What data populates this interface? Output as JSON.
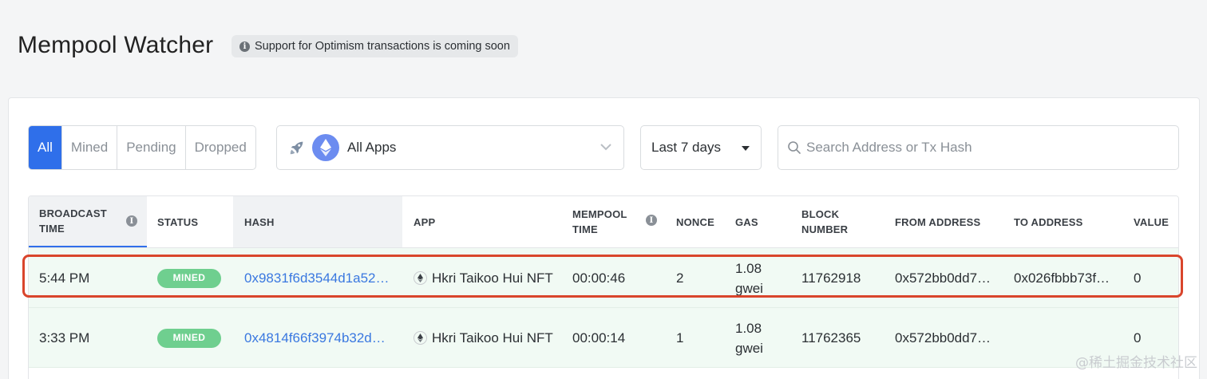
{
  "header": {
    "title": "Mempool Watcher",
    "notice": "Support for Optimism transactions is coming soon",
    "notice_icon": "info-icon"
  },
  "filters": {
    "tabs": [
      {
        "label": "All",
        "active": true
      },
      {
        "label": "Mined",
        "active": false
      },
      {
        "label": "Pending",
        "active": false
      },
      {
        "label": "Dropped",
        "active": false
      }
    ],
    "apps_select": {
      "label": "All Apps",
      "icons": [
        "rocket-icon",
        "ethereum-icon",
        "chevron-down-icon"
      ]
    },
    "period_select": {
      "label": "Last 7 days",
      "icon": "caret-down-icon"
    },
    "search": {
      "placeholder": "Search Address or Tx Hash",
      "value": "",
      "icon": "search-icon"
    }
  },
  "table": {
    "columns": [
      {
        "key": "broadcast_time",
        "label": "BROADCAST TIME",
        "has_info": true,
        "sorted": true
      },
      {
        "key": "status",
        "label": "STATUS"
      },
      {
        "key": "hash",
        "label": "HASH"
      },
      {
        "key": "app",
        "label": "APP"
      },
      {
        "key": "mempool_time",
        "label": "MEMPOOL TIME",
        "has_info": true
      },
      {
        "key": "nonce",
        "label": "NONCE"
      },
      {
        "key": "gas",
        "label": "GAS"
      },
      {
        "key": "block_number",
        "label": "BLOCK NUMBER"
      },
      {
        "key": "from_address",
        "label": "FROM ADDRESS"
      },
      {
        "key": "to_address",
        "label": "TO ADDRESS"
      },
      {
        "key": "value",
        "label": "VALUE"
      }
    ],
    "rows": [
      {
        "broadcast_time": "5:44 PM",
        "status": "MINED",
        "hash": "0x9831f6d3544d1a52…",
        "app": "Hkri Taikoo Hui NFT",
        "mempool_time": "00:00:46",
        "nonce": "2",
        "gas": "1.08\ngwei",
        "gas_value": "1.08",
        "gas_unit": "gwei",
        "block_number": "11762918",
        "from_address": "0x572bb0dd7…",
        "to_address": "0x026fbbb73f…",
        "value": "0",
        "highlighted": true
      },
      {
        "broadcast_time": "3:33 PM",
        "status": "MINED",
        "hash": "0x4814f66f3974b32d…",
        "app": "Hkri Taikoo Hui NFT",
        "mempool_time": "00:00:14",
        "nonce": "1",
        "gas_value": "1.08",
        "gas_unit": "gwei",
        "block_number": "11762365",
        "from_address": "0x572bb0dd7…",
        "to_address": "",
        "value": "0",
        "highlighted": false
      }
    ]
  },
  "colors": {
    "accent": "#2f6fea",
    "status_mined": "#6fcf8f",
    "link": "#3a78e0",
    "highlight_border": "#d9452c",
    "row_bg": "#f1faf4"
  },
  "watermark": "@稀土掘金技术社区"
}
